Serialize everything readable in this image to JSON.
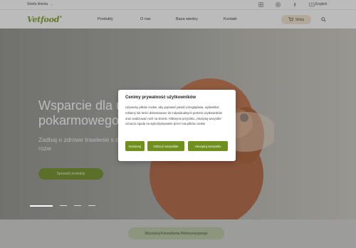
{
  "topbar": {
    "zone_label": "Strefa klienta",
    "language": "English",
    "icons": [
      "grid-icon",
      "instagram-icon",
      "facebook-icon",
      "youtube-icon"
    ]
  },
  "nav": {
    "logo": "Vetfood",
    "items": [
      "Produkty",
      "O nas",
      "Baza wiedzy",
      "Kontakt"
    ],
    "cart_label": "Sklep"
  },
  "hero": {
    "title": "Wsparcie dla układu pokarmowego",
    "subtitle": "Zadbaj o zdrowe trawienie s dzięki specjalistycznym rozw",
    "button_label": "Sprawdź produkty"
  },
  "bottom": {
    "consult_label": "Wyszukaj Konsultanta Weterynaryjnego"
  },
  "cookie": {
    "title": "Cenimy prywatność użytkowników",
    "text": "Używamy plików cookie, aby poprawić jakość przeglądania, wyświetlać reklamy lub treści dostosowane do indywidualnych potrzeb użytkowników oraz analizować ruch na stronie. Kliknięcie przycisku „Akceptuj wszystko” oznacza zgodę na wykorzystywanie przez nas plików cookie.",
    "customize_label": "Dostosuj",
    "reject_label": "Odrzuć wszystkie",
    "accept_label": "Akceptuj wszystko"
  },
  "colors": {
    "brand_green": "#6f8f1f",
    "cart_bg": "#f3e4cc"
  }
}
